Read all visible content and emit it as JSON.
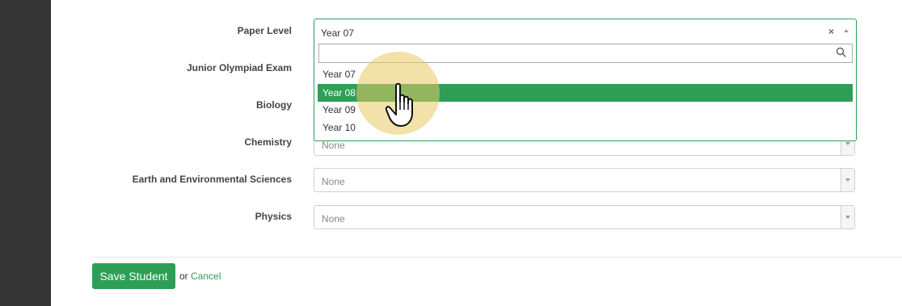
{
  "form": {
    "rows": [
      {
        "label": "Paper Level"
      },
      {
        "label": "Junior Olympiad Exam"
      },
      {
        "label": "Biology"
      },
      {
        "label": "Chemistry",
        "value": "None"
      },
      {
        "label": "Earth and Environmental Sciences",
        "value": "None"
      },
      {
        "label": "Physics",
        "value": "None"
      }
    ],
    "paper_level_dropdown": {
      "selected": "Year 07",
      "clear_symbol": "×",
      "search_placeholder": "",
      "options": [
        "Year 07",
        "Year 08",
        "Year 09",
        "Year 10"
      ],
      "highlighted_option": "Year 08"
    }
  },
  "actions": {
    "save_label": "Save Student",
    "or_text": "or",
    "cancel_label": "Cancel"
  },
  "colors": {
    "accent": "#2e9e57",
    "sidebar": "#343434",
    "cursor_halo": "#e8c862"
  },
  "icons": [
    "search-icon",
    "hand-pointer-icon",
    "chevron-down-icon",
    "chevron-up-icon",
    "clear-icon"
  ]
}
